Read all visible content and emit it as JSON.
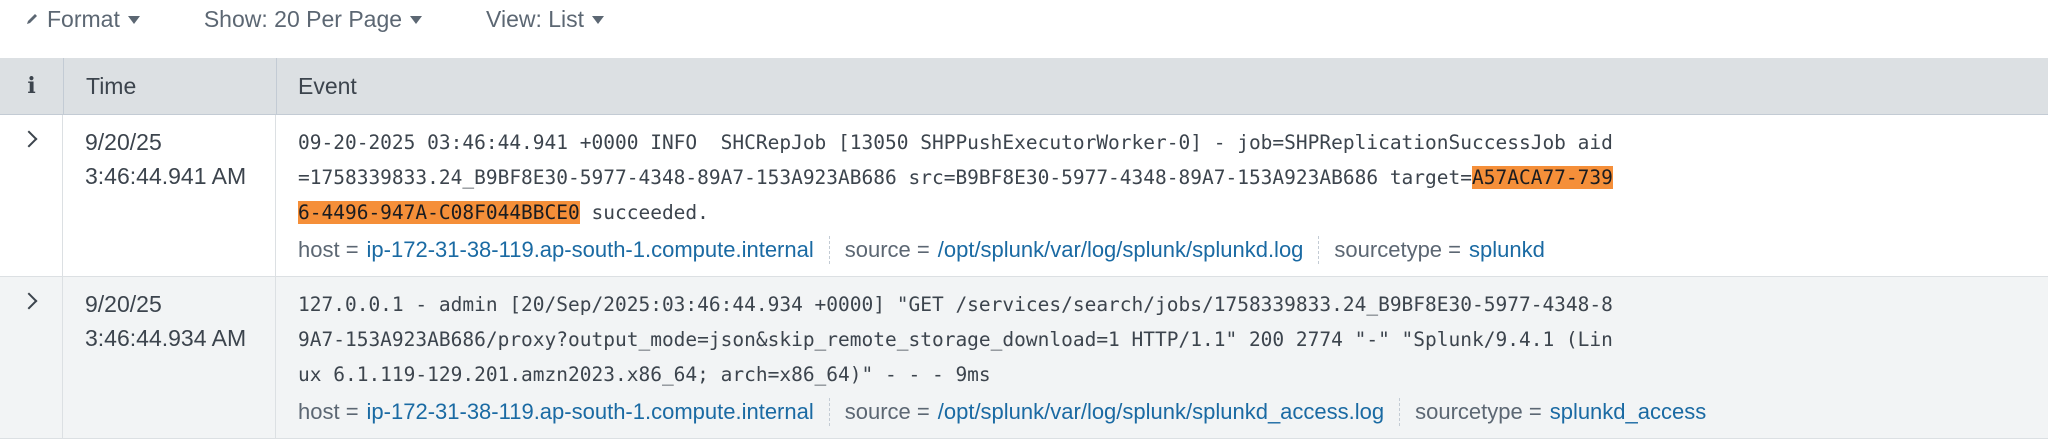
{
  "toolbar": {
    "format_label": "Format",
    "show_label": "Show: 20 Per Page",
    "view_label": "View: List"
  },
  "table": {
    "headers": {
      "info": "i",
      "time": "Time",
      "event": "Event"
    }
  },
  "events": [
    {
      "date": "9/20/25",
      "time": "3:46:44.941 AM",
      "raw_before": "09-20-2025 03:46:44.941 +0000 INFO  SHCRepJob [13050 SHPPushExecutorWorker-0] - job=SHPReplicationSuccessJob aid=1758339833.24_B9BF8E30-5977-4348-89A7-153A923AB686 src=B9BF8E30-5977-4348-89A7-153A923AB686 target=",
      "raw_highlight": "A57ACA77-7396-4496-947A-C08F044BBCE0",
      "raw_after": " succeeded.",
      "host_key": "host =",
      "host": "ip-172-31-38-119.ap-south-1.compute.internal",
      "source_key": "source =",
      "source": "/opt/splunk/var/log/splunk/splunkd.log",
      "sourcetype_key": "sourcetype =",
      "sourcetype": "splunkd"
    },
    {
      "date": "9/20/25",
      "time": "3:46:44.934 AM",
      "raw": "127.0.0.1 - admin [20/Sep/2025:03:46:44.934 +0000] \"GET /services/search/jobs/1758339833.24_B9BF8E30-5977-4348-89A7-153A923AB686/proxy?output_mode=json&skip_remote_storage_download=1 HTTP/1.1\" 200 2774 \"-\" \"Splunk/9.4.1 (Linux 6.1.119-129.201.amzn2023.x86_64; arch=x86_64)\" - - - 9ms",
      "host_key": "host =",
      "host": "ip-172-31-38-119.ap-south-1.compute.internal",
      "source_key": "source =",
      "source": "/opt/splunk/var/log/splunk/splunkd_access.log",
      "sourcetype_key": "sourcetype =",
      "sourcetype": "splunkd_access"
    }
  ]
}
